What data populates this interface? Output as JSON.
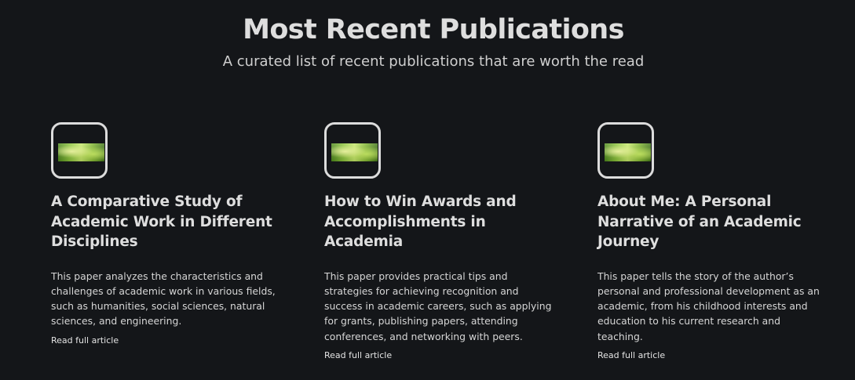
{
  "header": {
    "title": "Most Recent Publications",
    "subtitle": "A curated list of recent publications that are worth the read"
  },
  "publications": [
    {
      "thumbnail": "green-leaves-image",
      "title": "A Comparative Study of Academic Work in Different Disciplines",
      "description": "This paper analyzes the characteristics and challenges of academic work in various fields, such as humanities, social sciences, natural sciences, and engineering.",
      "link_label": "Read full article"
    },
    {
      "thumbnail": "green-leaves-image",
      "title": "How to Win Awards and Accomplishments in Academia",
      "description": "This paper provides practical tips and strategies for achieving recognition and success in academic careers, such as applying for grants, publishing papers, attending conferences, and networking with peers.",
      "link_label": "Read full article"
    },
    {
      "thumbnail": "green-leaves-image",
      "title": "About Me: A Personal Narrative of an Academic Journey",
      "description": "This paper tells the story of the author’s personal and professional development as an academic, from his childhood interests and education to his current research and teaching.",
      "link_label": "Read full article"
    }
  ],
  "colors": {
    "background": "#141619",
    "text": "#dedede",
    "thumbnail_border": "#dcdcdc"
  }
}
